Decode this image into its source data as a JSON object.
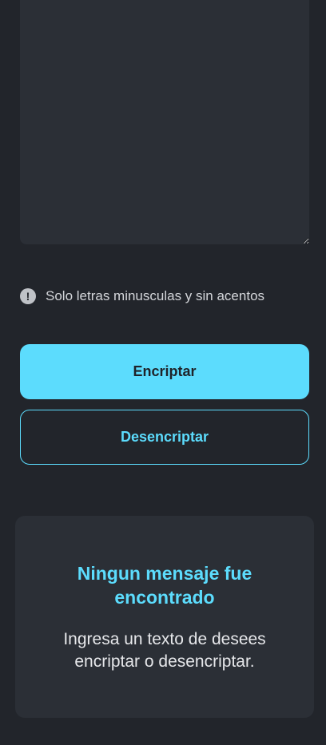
{
  "input": {
    "placeholder": ""
  },
  "hint": {
    "icon": "exclamation-circle-icon",
    "text": "Solo letras minusculas y sin acentos"
  },
  "buttons": {
    "encrypt_label": "Encriptar",
    "decrypt_label": "Desencriptar"
  },
  "result": {
    "title": "Ningun mensaje fue encontrado",
    "message": "Ingresa un texto de desees encriptar o desencriptar."
  },
  "colors": {
    "background": "#22252b",
    "panel": "#2b2f36",
    "accent": "#5cdcfd"
  }
}
